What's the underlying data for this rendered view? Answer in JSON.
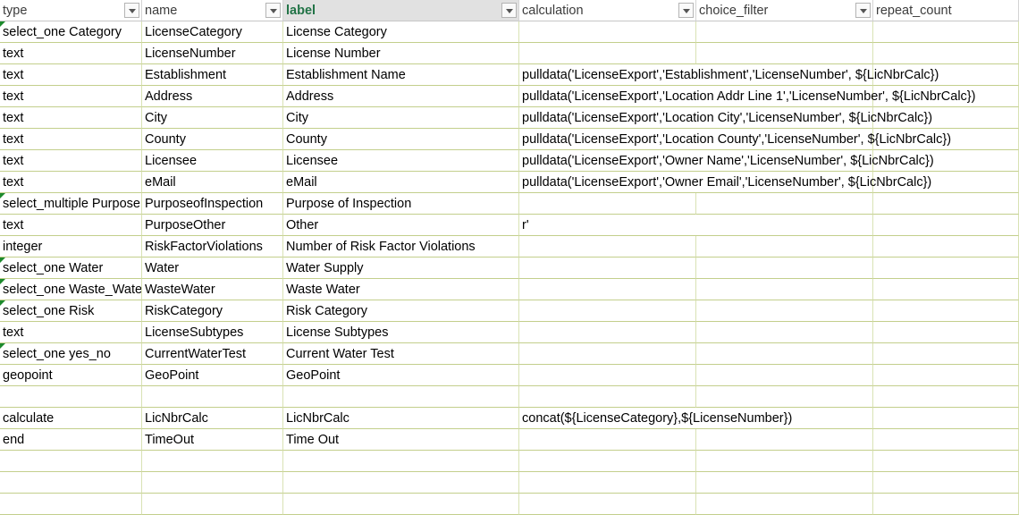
{
  "columns": [
    "type",
    "name",
    "label",
    "calculation",
    "choice_filter",
    "repeat_count"
  ],
  "rows": [
    {
      "type": "select_one Category",
      "name": "LicenseCategory",
      "label": "License Category",
      "calculation": "",
      "note": true
    },
    {
      "type": "text",
      "name": "LicenseNumber",
      "label": "License Number",
      "calculation": ""
    },
    {
      "type": "text",
      "name": "Establishment",
      "label": "Establishment Name",
      "calculation": "pulldata('LicenseExport','Establishment','LicenseNumber', ${LicNbrCalc})"
    },
    {
      "type": "text",
      "name": "Address",
      "label": "Address",
      "calculation": "pulldata('LicenseExport','Location Addr Line 1','LicenseNumber', ${LicNbrCalc})"
    },
    {
      "type": "text",
      "name": "City",
      "label": "City",
      "calculation": "pulldata('LicenseExport','Location City','LicenseNumber', ${LicNbrCalc})"
    },
    {
      "type": "text",
      "name": "County",
      "label": "County",
      "calculation": "pulldata('LicenseExport','Location County','LicenseNumber', ${LicNbrCalc})"
    },
    {
      "type": "text",
      "name": "Licensee",
      "label": "Licensee",
      "calculation": "pulldata('LicenseExport','Owner Name','LicenseNumber', ${LicNbrCalc})"
    },
    {
      "type": "text",
      "name": "eMail",
      "label": "eMail",
      "calculation": "pulldata('LicenseExport','Owner Email','LicenseNumber', ${LicNbrCalc})"
    },
    {
      "type": "select_multiple Purpose",
      "name": "PurposeofInspection",
      "label": "Purpose of Inspection",
      "calculation": "",
      "note": true
    },
    {
      "type": "text",
      "name": "PurposeOther",
      "label": "Other",
      "calculation": "r'"
    },
    {
      "type": "integer",
      "name": "RiskFactorViolations",
      "label": "Number of Risk Factor Violations",
      "calculation": ""
    },
    {
      "type": "select_one Water",
      "name": "Water",
      "label": "Water Supply",
      "calculation": "",
      "note": true
    },
    {
      "type": "select_one Waste_Water",
      "name": "WasteWater",
      "label": "Waste Water",
      "calculation": "",
      "note": true
    },
    {
      "type": "select_one Risk",
      "name": "RiskCategory",
      "label": "Risk Category",
      "calculation": "",
      "note": true
    },
    {
      "type": "text",
      "name": "LicenseSubtypes",
      "label": "License Subtypes",
      "calculation": ""
    },
    {
      "type": "select_one yes_no",
      "name": "CurrentWaterTest",
      "label": "Current Water Test",
      "calculation": "",
      "note": true
    },
    {
      "type": "geopoint",
      "name": "GeoPoint",
      "label": "GeoPoint",
      "calculation": ""
    },
    {
      "type": "",
      "name": "",
      "label": "",
      "calculation": ""
    },
    {
      "type": "calculate",
      "name": "LicNbrCalc",
      "label": "LicNbrCalc",
      "calculation": "concat(${LicenseCategory},${LicenseNumber})"
    },
    {
      "type": "end",
      "name": "TimeOut",
      "label": "Time Out",
      "calculation": ""
    },
    {
      "type": "",
      "name": "",
      "label": "",
      "calculation": ""
    },
    {
      "type": "",
      "name": "",
      "label": "",
      "calculation": ""
    },
    {
      "type": "",
      "name": "",
      "label": "",
      "calculation": ""
    }
  ]
}
